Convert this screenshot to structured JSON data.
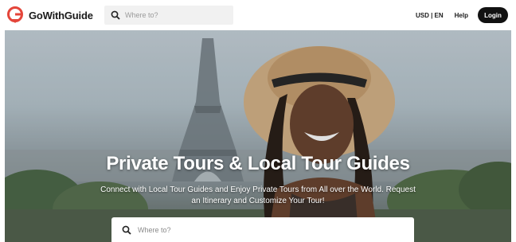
{
  "brand": {
    "name": "GoWithGuide",
    "accent": "#e4453a"
  },
  "header": {
    "search_placeholder": "Where to?",
    "lang_currency": "USD | EN",
    "help": "Help",
    "login": "Login"
  },
  "hero": {
    "title": "Private Tours & Local Tour Guides",
    "subtitle": "Connect with Local Tour Guides and Enjoy Private Tours from All over the World. Request an Itinerary and Customize Your Tour!",
    "search_placeholder": "Where to?"
  },
  "icons": {
    "search": "search-icon",
    "logo": "guide-pin-logo-icon"
  }
}
